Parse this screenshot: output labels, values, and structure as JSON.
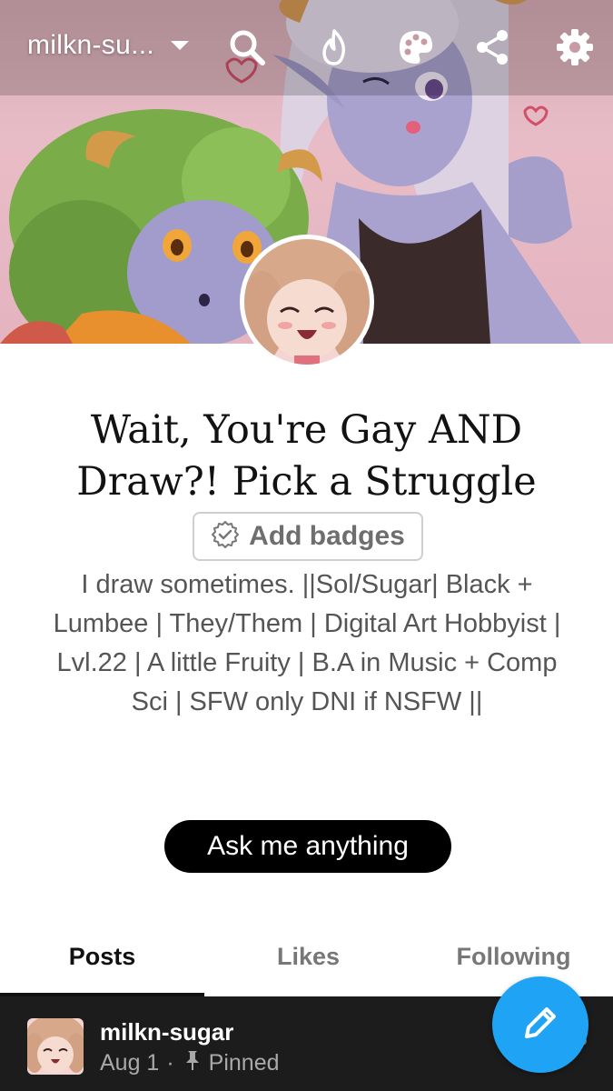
{
  "header": {
    "blog_name": "milkn-su...",
    "icons": [
      "chevron-down-icon",
      "search-icon",
      "fire-icon",
      "palette-icon",
      "share-icon",
      "gear-icon"
    ]
  },
  "profile": {
    "title": "Wait, You're Gay AND Draw?! Pick a Struggle",
    "badges_label": "Add badges",
    "bio": "I draw sometimes. ||Sol/Sugar| Black + Lumbee | They/Them | Digital Art Hobbyist | Lvl.22 | A little Fruity | B.A in Music + Comp Sci | SFW only DNI if NSFW ||",
    "ask_label": "Ask me anything"
  },
  "tabs": [
    {
      "label": "Posts",
      "active": true
    },
    {
      "label": "Likes",
      "active": false
    },
    {
      "label": "Following",
      "active": false
    }
  ],
  "post_preview": {
    "author": "milkn-sugar",
    "date": "Aug 1",
    "separator": "·",
    "pinned_label": "Pinned"
  },
  "colors": {
    "accent": "#1fa4f5",
    "banner_bg": "#e4b4c0",
    "post_bar_bg": "#1c1c1c"
  }
}
